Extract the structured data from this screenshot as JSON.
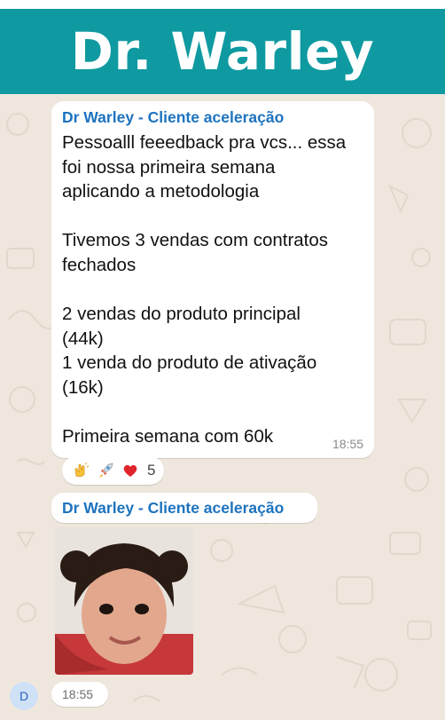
{
  "header": {
    "title": "Dr. Warley"
  },
  "chat": {
    "message1": {
      "sender": "Dr Warley - Cliente aceleração",
      "lines": [
        "Pessoalll feeedback pra vcs... essa",
        "foi nossa primeira semana",
        "aplicando a metodologia",
        "Tivemos 3 vendas com contratos",
        "fechados",
        "2 vendas do produto principal",
        "(44k)",
        "1 venda do produto de ativação",
        "(16k)",
        "Primeira semana com 60k"
      ],
      "time": "18:55",
      "reactions": {
        "count": "5",
        "icons": [
          "clapping-hands-emoji",
          "rocket-emoji",
          "red-heart-emoji"
        ]
      }
    },
    "message2": {
      "sender": "Dr Warley - Cliente aceleração",
      "image": "child-photo",
      "time": "18:55"
    },
    "avatar": {
      "initial": "D"
    }
  },
  "colors": {
    "header_bg": "#0f9aa1",
    "sender": "#1d73bf",
    "chat_bg": "#efe7dd"
  }
}
